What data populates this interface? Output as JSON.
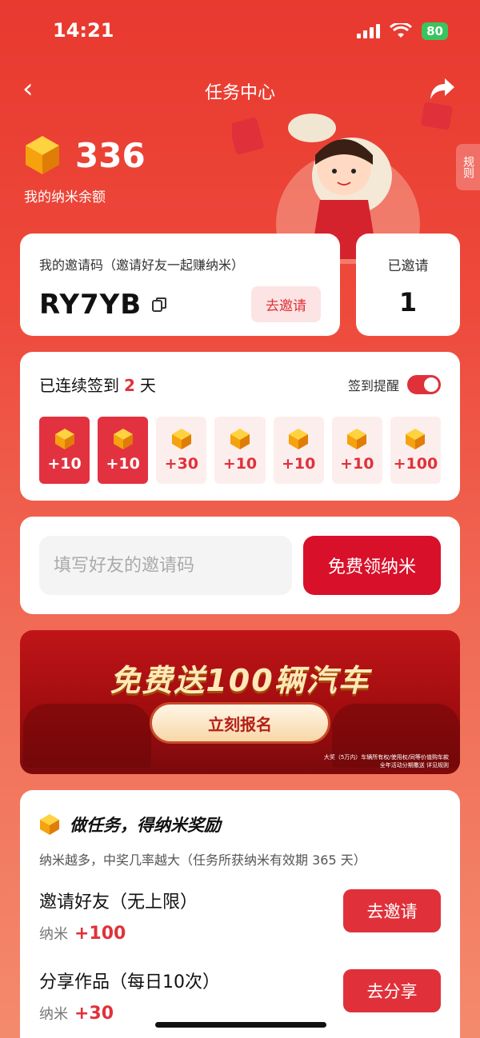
{
  "status_bar": {
    "time": "14:21",
    "battery": "80"
  },
  "nav": {
    "title": "任务中心"
  },
  "balance": {
    "value": "336",
    "label": "我的纳米余额"
  },
  "rules_tab": "规则",
  "invite": {
    "label": "我的邀请码（邀请好友一起赚纳米）",
    "code": "RY7YB",
    "button": "去邀请",
    "invited_label": "已邀请",
    "invited_count": "1"
  },
  "checkin": {
    "prefix": "已连续签到",
    "days": "2",
    "suffix": "天",
    "reminder_label": "签到提醒",
    "reminder_on": true,
    "rewards": [
      {
        "amount": "+10",
        "done": true
      },
      {
        "amount": "+10",
        "done": true
      },
      {
        "amount": "+30",
        "done": false
      },
      {
        "amount": "+10",
        "done": false
      },
      {
        "amount": "+10",
        "done": false
      },
      {
        "amount": "+10",
        "done": false
      },
      {
        "amount": "+100",
        "done": false
      }
    ]
  },
  "code_entry": {
    "placeholder": "填写好友的邀请码",
    "button": "免费领纳米"
  },
  "banner": {
    "title": "免费送100辆汽车",
    "button": "立刻报名",
    "fine_print_1": "大奖（5万内）车辆所有权/使用权/同等价值购车款",
    "fine_print_2": "全年活动分期撒送 详见规则"
  },
  "tasks": {
    "title": "做任务，得纳米奖励",
    "subtitle": "纳米越多，中奖几率越大（任务所获纳米有效期 365 天）",
    "reward_unit": "纳米",
    "items": [
      {
        "name": "邀请好友（无上限）",
        "reward": "+100",
        "button": "去邀请"
      },
      {
        "name": "分享作品（每日10次）",
        "reward": "+30",
        "button": "去分享"
      }
    ]
  },
  "colors": {
    "accent": "#e0313a",
    "background": "#e8392f"
  }
}
